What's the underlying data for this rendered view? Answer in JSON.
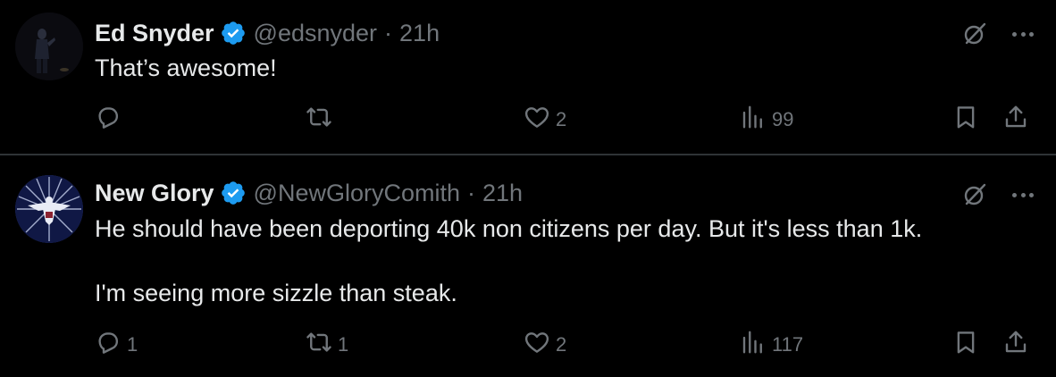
{
  "colors": {
    "background": "#000000",
    "primary_text": "#e7e9ea",
    "secondary_text": "#71767b",
    "verified_badge": "#1d9bf0",
    "divider": "#2f3336"
  },
  "tweets": [
    {
      "author_name": "Ed Snyder",
      "verified": true,
      "handle": "@edsnyder",
      "separator": "·",
      "time": "21h",
      "text": "That’s awesome!",
      "reply_count": "",
      "retweet_count": "",
      "like_count": "2",
      "view_count": "99",
      "icons": [
        "reply-icon",
        "retweet-icon",
        "like-icon",
        "views-icon",
        "bookmark-icon",
        "share-icon",
        "grok-icon",
        "more-icon"
      ]
    },
    {
      "author_name": "New Glory",
      "verified": true,
      "handle": "@NewGloryComith",
      "separator": "·",
      "time": "21h",
      "text": "He should have been deporting 40k non citizens per day. But it's less than 1k.\n\nI'm seeing more sizzle than steak.",
      "reply_count": "1",
      "retweet_count": "1",
      "like_count": "2",
      "view_count": "117",
      "icons": [
        "reply-icon",
        "retweet-icon",
        "like-icon",
        "views-icon",
        "bookmark-icon",
        "share-icon",
        "grok-icon",
        "more-icon"
      ]
    }
  ]
}
